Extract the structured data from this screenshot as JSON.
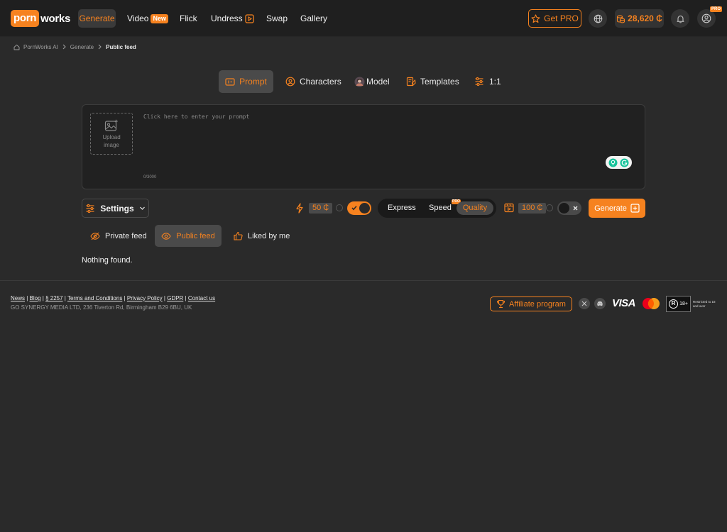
{
  "brand": {
    "logo_part1": "porn",
    "logo_part2": "works"
  },
  "nav": {
    "generate": "Generate",
    "video": "Video",
    "video_badge": "New",
    "flick": "Flick",
    "undress": "Undress",
    "swap": "Swap",
    "gallery": "Gallery"
  },
  "header": {
    "get_pro": "Get PRO",
    "balance": "28,620 ₵",
    "pro_badge": "PRO",
    "icons": [
      "globe-icon",
      "bell-icon",
      "user-icon"
    ]
  },
  "breadcrumb": [
    "PornWorks AI",
    "Generate",
    "Public feed"
  ],
  "mode_tabs": {
    "prompt": "Prompt",
    "characters": "Characters",
    "model": "Model",
    "templates": "Templates",
    "ratio": "1:1"
  },
  "prompt": {
    "upload_label_1": "Upload",
    "upload_label_2": "image",
    "placeholder": "Click here to enter your prompt",
    "char_count": "0/3000"
  },
  "settings": {
    "settings_label": "Settings",
    "cost_1": "50 ₵",
    "toggle_1_on": true,
    "quality_options": [
      "Express",
      "Speed",
      "Quality"
    ],
    "quality_selected": "Quality",
    "speed_badge": "PRO",
    "cost_2": "100 ₵",
    "toggle_2_on": false,
    "generate": "Generate"
  },
  "feed_tabs": {
    "private": "Private feed",
    "public": "Public feed",
    "liked": "Liked by me",
    "selected": "Public feed"
  },
  "feed": {
    "empty": "Nothing found."
  },
  "footer": {
    "links": [
      "News",
      "Blog",
      "§ 2257",
      "Terms and Conditions",
      "Privacy Policy",
      "GDPR",
      "Contact us"
    ],
    "address": "GO SYNERGY MEDIA LTD, 236 Tiverton Rd, Birmingham B29 6BU, UK",
    "affiliate": "Affiliate program",
    "visa": "VISA",
    "rta_18": "18+",
    "rta_text": "Restricted to 18 and over"
  },
  "colors": {
    "accent": "#f6821f",
    "background": "#2a2a2a",
    "header": "#1f1f1f"
  }
}
